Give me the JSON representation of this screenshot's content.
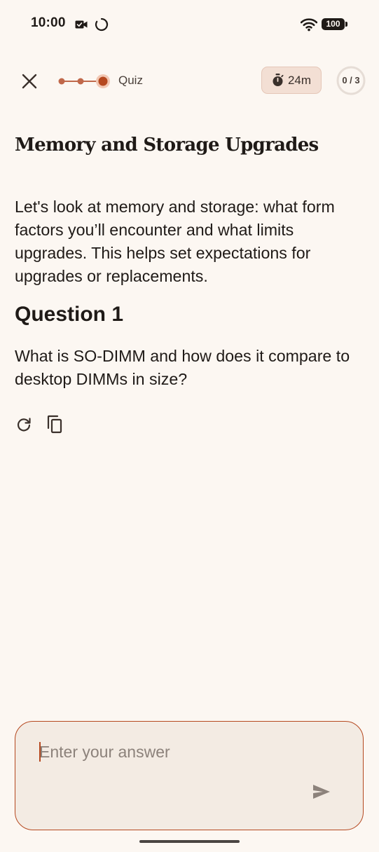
{
  "status_bar": {
    "time": "10:00",
    "battery": "100",
    "icons": [
      "video-camera-icon",
      "loading-spinner-icon",
      "wifi-icon",
      "battery-icon"
    ]
  },
  "header": {
    "close_icon": "close-icon",
    "step_label": "Quiz",
    "steps_total": 3,
    "current_step": 3,
    "timer": "24m",
    "timer_icon": "stopwatch-icon",
    "progress_text": "0 / 3",
    "progress_fraction": 0
  },
  "content": {
    "title": "Memory and Storage Upgrades",
    "intro": "Let's look at memory and storage: what form factors you’ll encounter and what limits upgrades. This helps set expectations for upgrades or replacements.",
    "question_heading": "Question 1",
    "question_text": "What is SO-DIMM and how does it compare to desktop DIMMs in size?",
    "actions": [
      "refresh-icon",
      "copy-icon"
    ]
  },
  "answer": {
    "placeholder": "Enter your answer",
    "value": "",
    "send_icon": "send-icon"
  },
  "colors": {
    "background": "#fcf7f2",
    "accent": "#b5481f",
    "accent_light": "#f3dfd4",
    "text": "#1f1a17",
    "input_background": "#f3ebe3"
  }
}
